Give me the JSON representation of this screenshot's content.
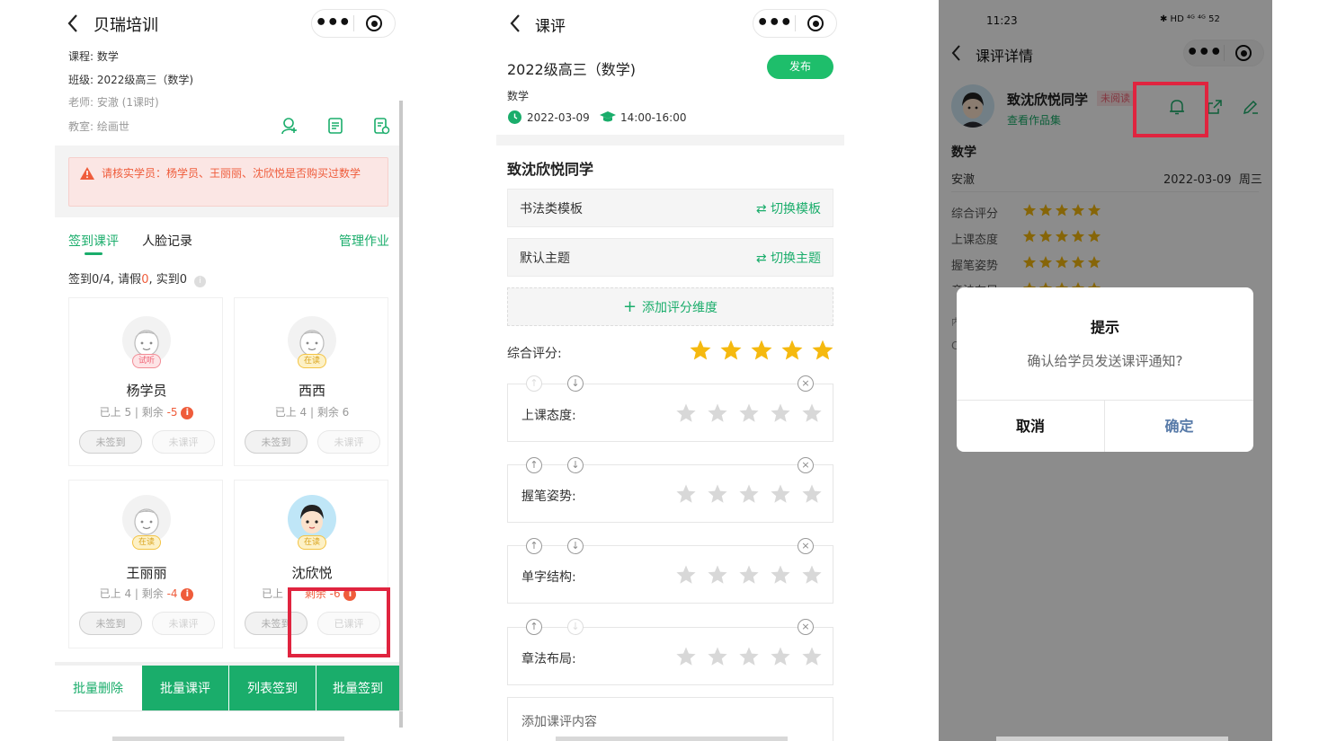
{
  "left": {
    "nav_title": "贝瑞培训",
    "course": "课程: 数学",
    "class": "班级: 2022级高三（数学)",
    "teacher": "老师: 安澈 (1课时)",
    "room": "教室: 绘画世",
    "warning": "请核实学员：杨学员、王丽丽、沈欣悦是否购买过数学",
    "tabs": [
      "签到课评",
      "人脸记录"
    ],
    "manage_homework": "管理作业",
    "summary_prefix": "签到0/4, 请假",
    "summary_leave": "0",
    "summary_suffix": ", 实到0",
    "students": [
      {
        "name": "杨学员",
        "badge": "试听",
        "stats_prefix": "已上 5 | 剩余",
        "stats_remain": "-5",
        "btn1": "未签到",
        "btn2": "未课评"
      },
      {
        "name": "西西",
        "badge": "在读",
        "stats_prefix": "已上 4 | 剩余 6",
        "stats_remain": "",
        "btn1": "未签到",
        "btn2": "未课评"
      },
      {
        "name": "王丽丽",
        "badge": "在读",
        "stats_prefix": "已上 4 | 剩余",
        "stats_remain": "-4",
        "btn1": "未签到",
        "btn2": "未课评"
      },
      {
        "name": "沈欣悦",
        "badge": "在读",
        "stats_prefix": "已上",
        "stats_remain": "剩余 -6",
        "btn1": "未签到",
        "btn2": "已课评"
      }
    ],
    "bottom": [
      "批量删除",
      "批量课评",
      "列表签到",
      "批量签到"
    ]
  },
  "middle": {
    "nav_title": "课评",
    "class_title": "2022级高三（数学)",
    "publish": "发布",
    "subject": "数学",
    "date": "2022-03-09",
    "time": "14:00-16:00",
    "to": "致沈欣悦同学",
    "template": "书法类模板",
    "switch_template": "切换模板",
    "theme": "默认主题",
    "switch_theme": "切换主题",
    "add_dimension": "添加评分维度",
    "overall": "综合评分:",
    "dimensions": [
      "上课态度:",
      "握笔姿势:",
      "单字结构:",
      "章法布局:"
    ],
    "add_content": "添加课评内容"
  },
  "right": {
    "time": "11:23",
    "status_icons": "✱ HD ⁴ᴳ ⁴ᴳ 52",
    "nav_title": "课评详情",
    "student": "致沈欣悦同学",
    "unread": "未阅读",
    "portfolio": "查看作品集",
    "subject": "数学",
    "teacher": "安澈",
    "date": "2022-03-09",
    "weekday": "周三",
    "ratings": [
      "综合评分",
      "上课态度",
      "握笔姿势"
    ],
    "partial_rating": "章法布局",
    "hidden_text_1": "内",
    "hidden_text_2": "C",
    "dialog": {
      "title": "提示",
      "message": "确认给学员发送课评通知?",
      "cancel": "取消",
      "confirm": "确定"
    }
  },
  "colors": {
    "green": "#1aad6b",
    "red": "#e0243f",
    "star": "#f5b90f",
    "warning_bg": "#fbe6e4"
  }
}
